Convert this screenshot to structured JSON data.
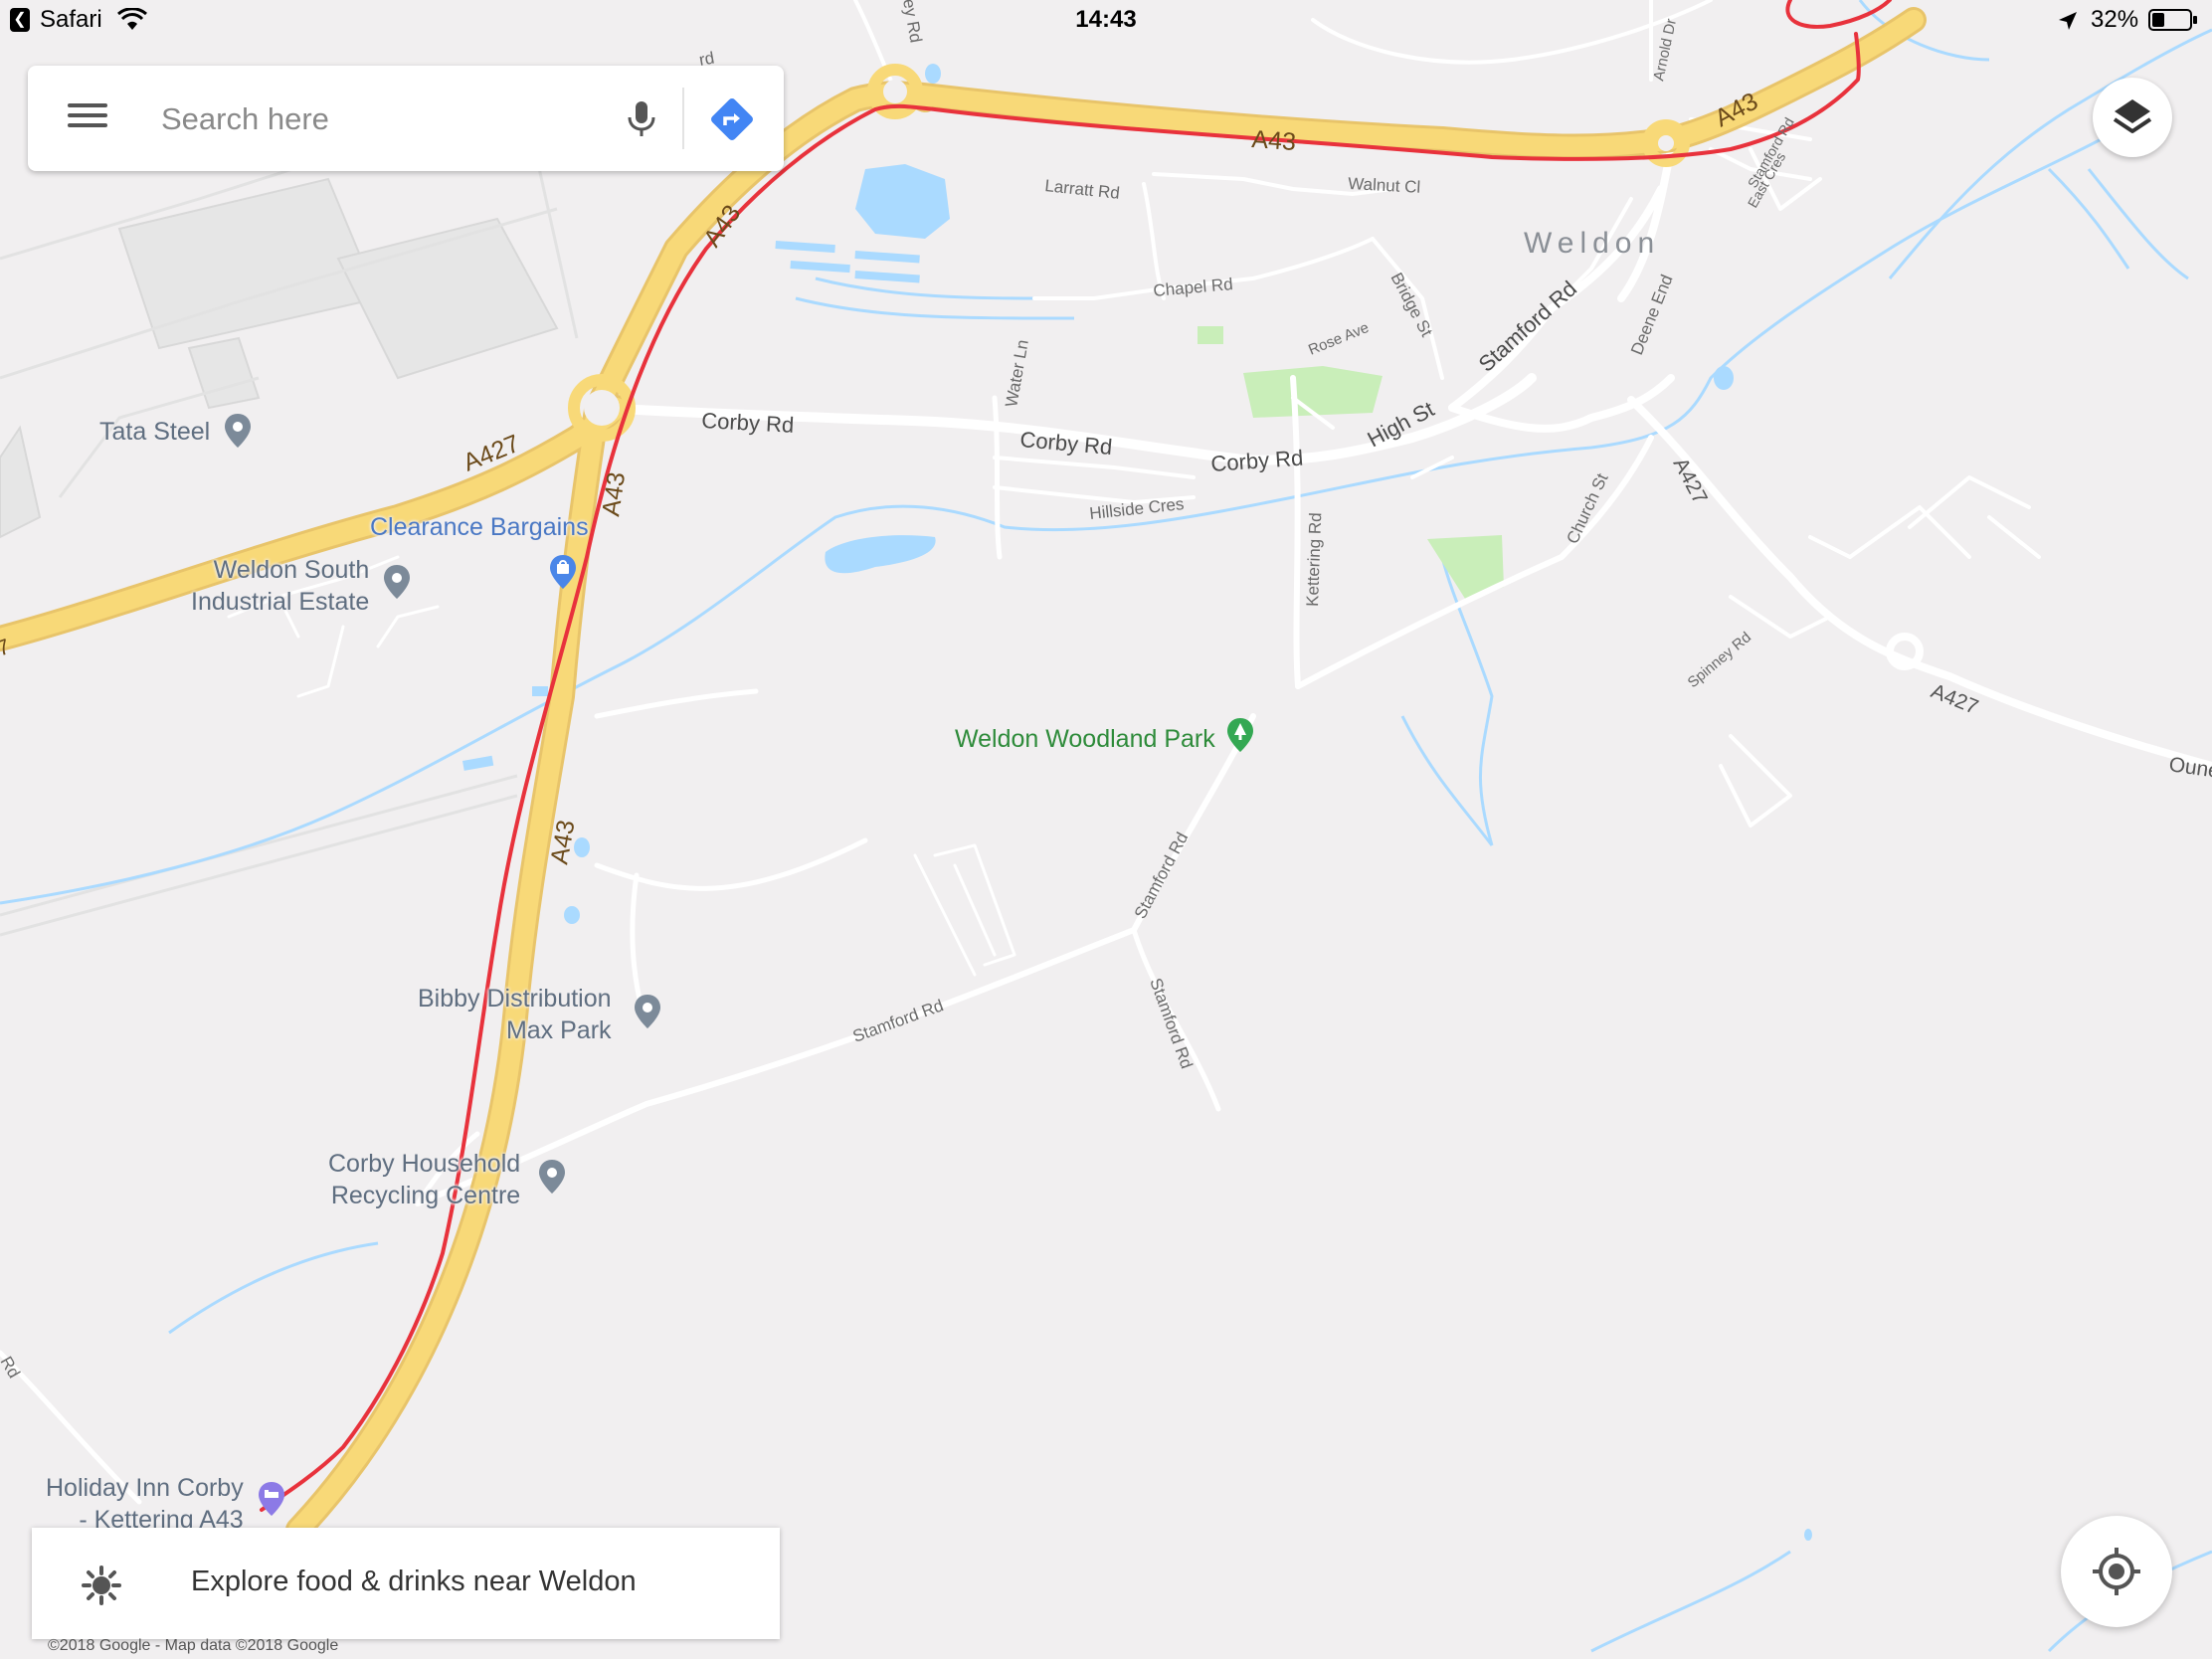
{
  "status_bar": {
    "back_app": "Safari",
    "time": "14:43",
    "battery": "32%"
  },
  "search": {
    "placeholder": "Search here"
  },
  "map": {
    "area_label": "Weldon",
    "road_labels": {
      "a43": "A43",
      "a427": "A427",
      "corby_rd": "Corby Rd",
      "high_st": "High St",
      "stamford_rd": "Stamford Rd",
      "larratt_rd": "Larratt Rd",
      "walnut_cl": "Walnut Cl",
      "chapel_rd": "Chapel Rd",
      "rose_ave": "Rose Ave",
      "bridge_st": "Bridge St",
      "water_ln": "Water Ln",
      "hillside_cres": "Hillside Cres",
      "kettering_rd": "Kettering Rd",
      "church_st": "Church St",
      "deene_end": "Deene End",
      "arnold_dr": "Arnold Dr",
      "east_cres": "East Cres",
      "spinney_rd": "Spinney Rd",
      "ey_rd": "ey Rd",
      "rd": "Rd",
      "rd_fragment": "rd",
      "oune": "Oune",
      "seven": "7"
    },
    "places": [
      {
        "name": "Tata Steel"
      },
      {
        "name": "Clearance Bargains"
      },
      {
        "name": "Weldon South\nIndustrial Estate"
      },
      {
        "name": "Weldon Woodland Park"
      },
      {
        "name": "Bibby Distribution\nMax Park"
      },
      {
        "name": "Corby Household\nRecycling Centre"
      },
      {
        "name": "Holiday Inn Corby\n- Kettering A43"
      }
    ],
    "route_color": "#e8323c",
    "highway_color": "#f8d978",
    "water_color": "#aadaff",
    "park_color": "#c9eeb9"
  },
  "explore": {
    "label": "Explore food & drinks near Weldon"
  },
  "copyright": "©2018 Google - Map data ©2018 Google"
}
